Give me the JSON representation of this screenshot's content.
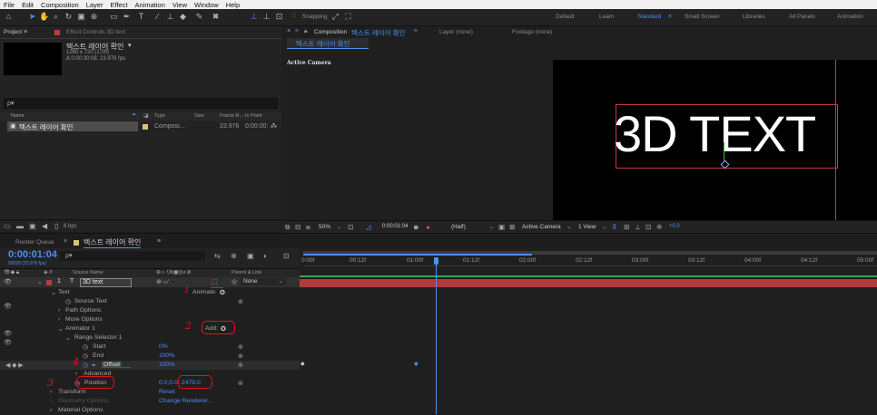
{
  "menu": [
    "File",
    "Edit",
    "Composition",
    "Layer",
    "Effect",
    "Animation",
    "View",
    "Window",
    "Help"
  ],
  "toolbar": {
    "snapping_label": "Snapping",
    "workspaces": [
      "Default",
      "Learn",
      "Standard",
      "Small Screen",
      "Libraries",
      "All Panels",
      "Animation"
    ],
    "active_workspace": "Standard"
  },
  "project": {
    "tab_label": "Project",
    "effect_controls_tab": "Effect Controls 3D text",
    "comp_name": "텍스트 레이어 확인",
    "comp_size": "1280 x 720 (1.00)",
    "comp_duration": "Δ 0:00:30:08, 23.976 fps",
    "search_placeholder": "ρ▾",
    "columns": [
      "Name",
      "Type",
      "Size",
      "Frame R...",
      "In Point"
    ],
    "item": {
      "name": "텍스트 레이어 확인",
      "type": "Composi...",
      "frame_rate": "23.976",
      "in_point": "0:00:00:"
    },
    "bpc": "8 bpc"
  },
  "composition": {
    "tab_label": "Composition",
    "tab_name": "텍스트 레이어 확인",
    "layer_tab": "Layer (none)",
    "footage_tab": "Footage (none)",
    "breadcrumb": "텍스트 레이어 확인",
    "active_camera": "Active Camera",
    "viewer_text": "3D TEXT",
    "zoom": "50%",
    "timecode": "0:00:01:04",
    "resolution": "(Half)",
    "camera_select": "Active Camera",
    "view_select": "1 View",
    "exposure": "+0.0"
  },
  "timeline": {
    "render_queue_tab": "Render Queue",
    "comp_tab": "텍스트 레이어 확인",
    "timecode": "0:00:01:04",
    "timecode_sub": "00028 (23.976 fps)",
    "search_placeholder": "ρ▾",
    "col_source": "Source Name",
    "col_parent": "Parent & Link",
    "layer": {
      "index": "1",
      "name": "3D text",
      "parent": "None"
    },
    "animate_label": "Animate:",
    "add_label": "Add:",
    "rows": [
      {
        "label": "Text",
        "value": ""
      },
      {
        "label": "Source Text",
        "value": ""
      },
      {
        "label": "Path Options",
        "value": ""
      },
      {
        "label": "More Options",
        "value": ""
      },
      {
        "label": "Animator 1",
        "value": ""
      },
      {
        "label": "Range Selector 1",
        "value": ""
      },
      {
        "label": "Start",
        "value": "0%"
      },
      {
        "label": "End",
        "value": "100%"
      },
      {
        "label": "Offset",
        "value": "100%"
      },
      {
        "label": "Advanced",
        "value": ""
      },
      {
        "label": "Position",
        "value": "0.0,0.0,-2479.0"
      },
      {
        "label": "Transform",
        "value": "Reset"
      },
      {
        "label": "Geometry Options",
        "value": "Change Renderer..."
      },
      {
        "label": "Material Options",
        "value": ""
      }
    ],
    "ruler": [
      "0:00f",
      "00:12f",
      "01:00f",
      "01:12f",
      "02:00f",
      "02:12f",
      "03:00f",
      "03:12f",
      "04:00f",
      "04:12f",
      "05:00f"
    ]
  },
  "annotations": [
    "1",
    "2",
    "3",
    "4"
  ],
  "colors": {
    "accent": "#4c8ff5",
    "layer_bar": "#b23a3a",
    "annotation": "#e0161b",
    "selection": "#e0161b"
  }
}
